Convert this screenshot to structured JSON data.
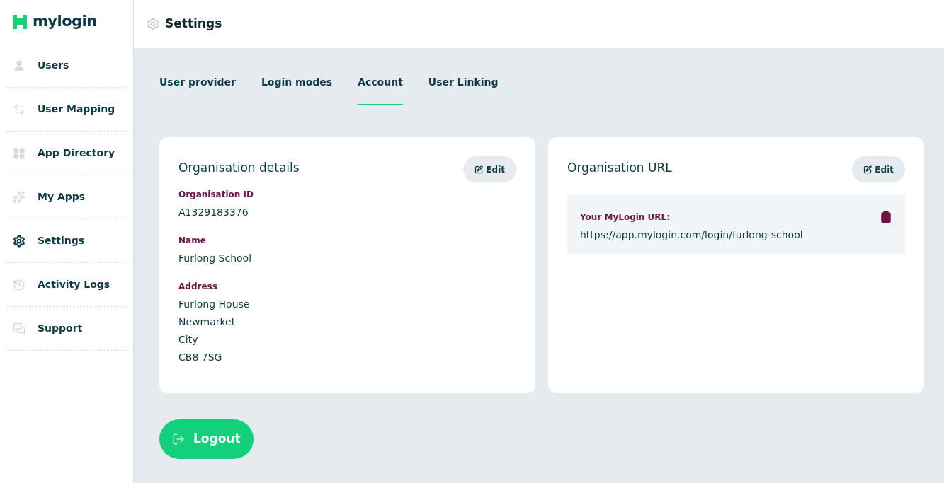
{
  "brand": {
    "name": "mylogin"
  },
  "sidebar": {
    "items": [
      {
        "label": "Users",
        "selected": false
      },
      {
        "label": "User Mapping",
        "selected": false
      },
      {
        "label": "App Directory",
        "selected": false
      },
      {
        "label": "My Apps",
        "selected": false
      },
      {
        "label": "Settings",
        "selected": true
      },
      {
        "label": "Activity Logs",
        "selected": false
      },
      {
        "label": "Support",
        "selected": false
      }
    ]
  },
  "header": {
    "title": "Settings"
  },
  "tabs": [
    {
      "label": "User provider",
      "selected": false
    },
    {
      "label": "Login modes",
      "selected": false
    },
    {
      "label": "Account",
      "selected": true
    },
    {
      "label": "User Linking",
      "selected": false
    }
  ],
  "org_details": {
    "title": "Organisation details",
    "edit_button": "Edit",
    "fields": [
      {
        "label": "Organisation ID",
        "lines": [
          "A1329183376"
        ]
      },
      {
        "label": "Name",
        "lines": [
          "Furlong School"
        ]
      },
      {
        "label": "Address",
        "lines": [
          "Furlong House",
          "Newmarket",
          "City",
          "CB8 7SG"
        ]
      }
    ]
  },
  "org_url": {
    "title": "Organisation URL",
    "edit_button": "Edit",
    "label": "Your MyLogin URL:",
    "url": "https://app.mylogin.com/login/furlong-school"
  },
  "logout_button": "Logout"
}
